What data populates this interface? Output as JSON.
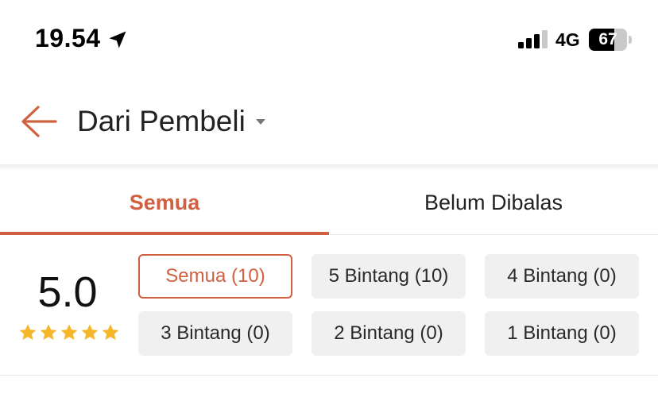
{
  "status_bar": {
    "time": "19.54",
    "network": "4G",
    "battery_level": "67",
    "battery_fraction": 0.67
  },
  "header": {
    "title": "Dari Pembeli",
    "back_icon": "arrow-left-icon",
    "dropdown_icon": "caret-down-icon"
  },
  "tabs": [
    {
      "label": "Semua",
      "active": true
    },
    {
      "label": "Belum Dibalas",
      "active": false
    }
  ],
  "rating": {
    "score": "5.0",
    "stars": 5,
    "star_color": "#f5b62a"
  },
  "filters": [
    {
      "label": "Semua (10)",
      "active": true
    },
    {
      "label": "5 Bintang (10)",
      "active": false
    },
    {
      "label": "4 Bintang (0)",
      "active": false
    },
    {
      "label": "3 Bintang (0)",
      "active": false
    },
    {
      "label": "2 Bintang (0)",
      "active": false
    },
    {
      "label": "1 Bintang (0)",
      "active": false
    }
  ],
  "colors": {
    "accent": "#d0603f",
    "chip_bg": "#f0f0f0"
  }
}
